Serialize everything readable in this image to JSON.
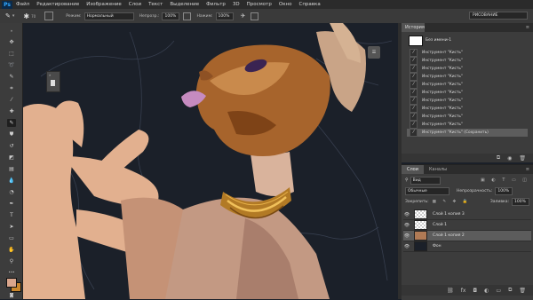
{
  "app": {
    "logo": "Ps"
  },
  "menu": [
    "Файл",
    "Редактирование",
    "Изображение",
    "Слои",
    "Текст",
    "Выделение",
    "Фильтр",
    "3D",
    "Просмотр",
    "Окно",
    "Справка"
  ],
  "options": {
    "mode_label": "Режим:",
    "mode_value": "Нормальный",
    "opacity_label": "Непрозр.:",
    "opacity_value": "100%",
    "pressure_label": "Нажим:",
    "pressure_value": "100%",
    "workspace": "РИСОВАНИЕ"
  },
  "history": {
    "tab": "История",
    "snapshot_label": "Без имени-1",
    "items": [
      "Инструмент \"Кисть\"",
      "Инструмент \"Кисть\"",
      "Инструмент \"Кисть\"",
      "Инструмент \"Кисть\"",
      "Инструмент \"Кисть\"",
      "Инструмент \"Кисть\"",
      "Инструмент \"Кисть\"",
      "Инструмент \"Кисть\"",
      "Инструмент \"Кисть\"",
      "Инструмент \"Кисть\"",
      "Инструмент \"Кисть\" (Сохранить)"
    ]
  },
  "layers": {
    "tabs": [
      "Слои",
      "Каналы"
    ],
    "filter_label": "Вид",
    "blend_mode": "Обычные",
    "opacity_label": "Непрозрачность:",
    "opacity_value": "100%",
    "lock_label": "Закрепить:",
    "fill_label": "Заливка:",
    "fill_value": "100%",
    "items": [
      {
        "name": "Слой 1 копия 3",
        "selected": false
      },
      {
        "name": "Слой 1",
        "selected": false
      },
      {
        "name": "Слой 1 копия 2",
        "selected": true
      },
      {
        "name": "Фон",
        "selected": false
      }
    ]
  },
  "colors": {
    "foreground": "#d9a58c",
    "background": "#c9862c",
    "canvas": "#1b2029",
    "panel": "#3c3c3c"
  }
}
